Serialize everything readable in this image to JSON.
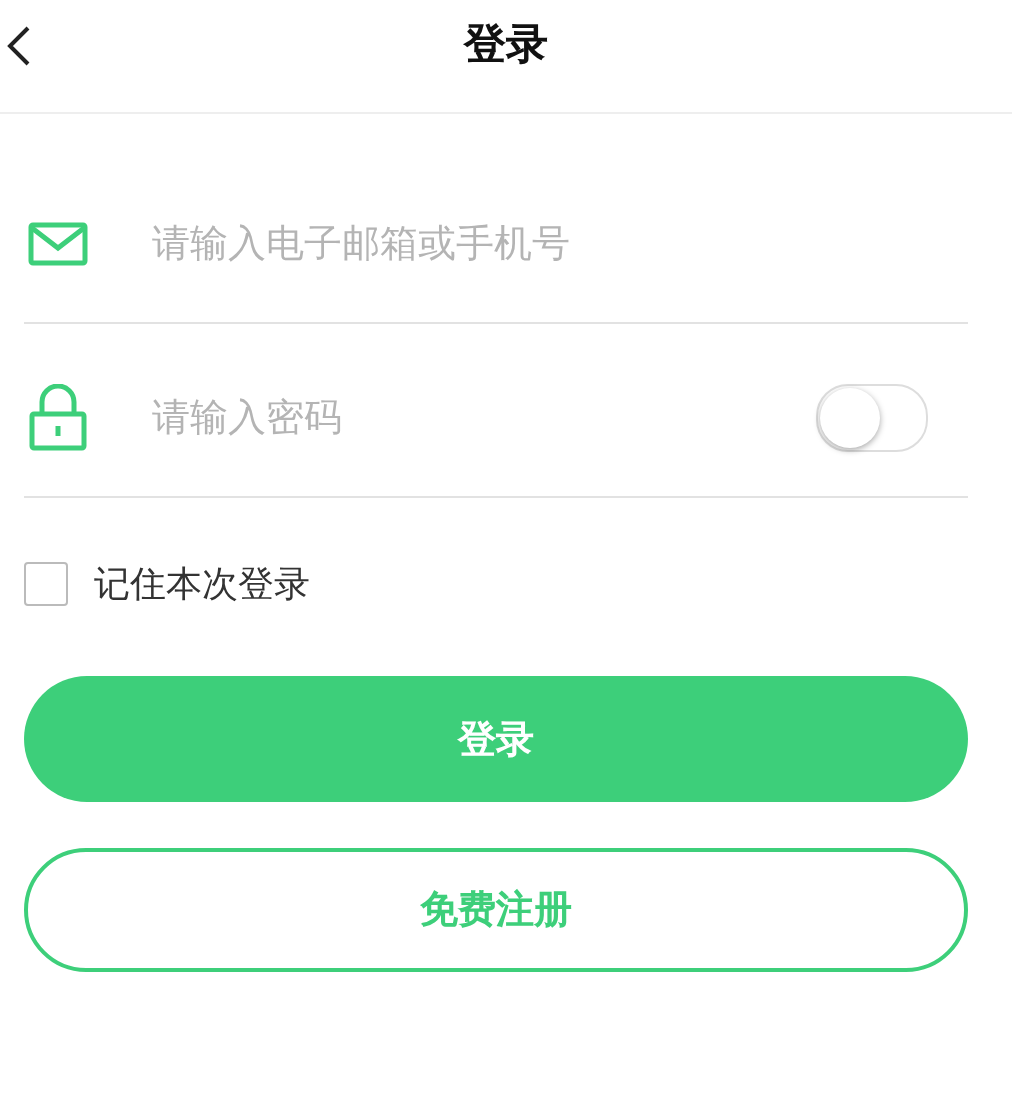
{
  "header": {
    "title": "登录"
  },
  "fields": [
    {
      "kind": "email",
      "placeholder": "请输入电子邮箱或手机号"
    },
    {
      "kind": "password",
      "placeholder": "请输入密码",
      "show_password": false
    }
  ],
  "remember": {
    "label": "记住本次登录",
    "checked": false
  },
  "buttons": [
    {
      "kind": "primary",
      "label": "登录"
    },
    {
      "kind": "outline",
      "label": "免费注册"
    }
  ]
}
